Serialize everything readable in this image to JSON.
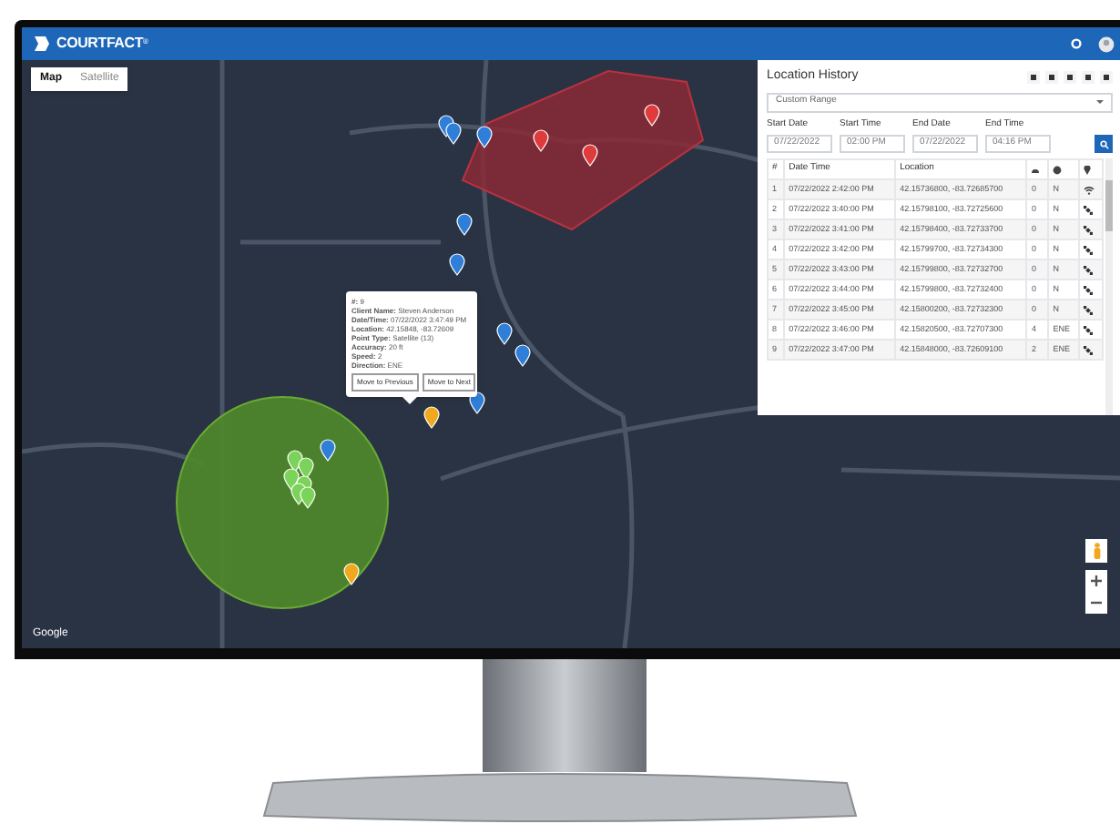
{
  "app": {
    "logo": "COURTFACT",
    "logo_mark": "®"
  },
  "map_type_tabs": [
    {
      "label": "Map",
      "selected": true
    },
    {
      "label": "Satellite",
      "selected": false
    }
  ],
  "location_history": {
    "title": "Location History",
    "range": "Custom Range",
    "filters": [
      {
        "label": "Start Date",
        "value": "07/22/2022"
      },
      {
        "label": "Start Time",
        "value": "02:00 PM"
      },
      {
        "label": "End Date",
        "value": "07/22/2022"
      },
      {
        "label": "End Time",
        "value": "04:16 PM"
      }
    ],
    "columns": [
      "#",
      "Date Time",
      "Location"
    ],
    "rows": [
      {
        "cells": [
          "1",
          "07/22/2022 2:42:00 PM",
          "42.15736800, -83.72685700",
          "0",
          "N"
        ],
        "kind": "wifi"
      },
      {
        "cells": [
          "2",
          "07/22/2022 3:40:00 PM",
          "42.15798100, -83.72725600",
          "0",
          "N"
        ],
        "kind": "satellite"
      },
      {
        "cells": [
          "3",
          "07/22/2022 3:41:00 PM",
          "42.15798400, -83.72733700",
          "0",
          "N"
        ],
        "kind": "satellite"
      },
      {
        "cells": [
          "4",
          "07/22/2022 3:42:00 PM",
          "42.15799700, -83.72734300",
          "0",
          "N"
        ],
        "kind": "satellite"
      },
      {
        "cells": [
          "5",
          "07/22/2022 3:43:00 PM",
          "42.15799800, -83.72732700",
          "0",
          "N"
        ],
        "kind": "satellite"
      },
      {
        "cells": [
          "6",
          "07/22/2022 3:44:00 PM",
          "42.15799800, -83.72732400",
          "0",
          "N"
        ],
        "kind": "satellite"
      },
      {
        "cells": [
          "7",
          "07/22/2022 3:45:00 PM",
          "42.15800200, -83.72732300",
          "0",
          "N"
        ],
        "kind": "satellite"
      },
      {
        "cells": [
          "8",
          "07/22/2022 3:46:00 PM",
          "42.15820500, -83.72707300",
          "4",
          "ENE"
        ],
        "kind": "satellite"
      },
      {
        "cells": [
          "9",
          "07/22/2022 3:47:00 PM",
          "42.15848000, -83.72609100",
          "2",
          "ENE"
        ],
        "kind": "satellite"
      }
    ]
  },
  "popup": {
    "lines": [
      {
        "label": "#:",
        "value": "9"
      },
      {
        "label": "Client Name:",
        "value": "Steven Anderson"
      },
      {
        "label": "Date/Time:",
        "value": "07/22/2022 3:47:49 PM"
      },
      {
        "label": "Location:",
        "value": "42.15848, -83.72609"
      },
      {
        "label": "Point Type:",
        "value": "Satellite (13)"
      },
      {
        "label": "Accuracy:",
        "value": "20 ft"
      },
      {
        "label": "Speed:",
        "value": "2"
      },
      {
        "label": "Direction:",
        "value": "ENE"
      }
    ],
    "buttons": [
      "Move to Previous",
      "Move to Next"
    ]
  },
  "attribution": "Google"
}
